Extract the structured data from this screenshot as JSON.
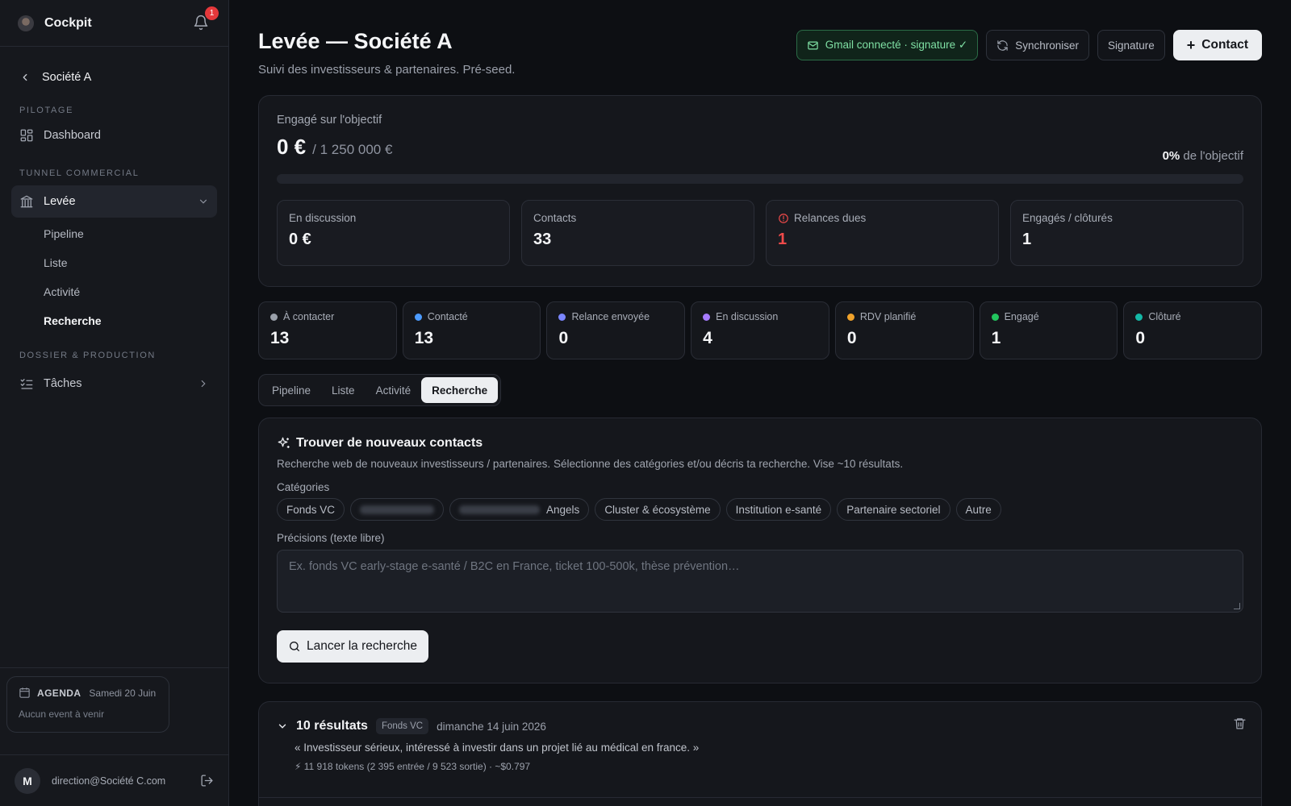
{
  "app": {
    "title": "Cockpit",
    "notifications": "1"
  },
  "sidebar": {
    "org": "Société A",
    "sections": {
      "pilotage": "PILOTAGE",
      "tunnel": "TUNNEL COMMERCIAL",
      "dossier": "DOSSIER & PRODUCTION"
    },
    "dashboard": "Dashboard",
    "levee": "Levée",
    "sub": [
      "Pipeline",
      "Liste",
      "Activité",
      "Recherche"
    ],
    "taches": "Tâches",
    "agenda": {
      "label": "AGENDA",
      "date": "Samedi 20 Juin",
      "empty": "Aucun event à venir"
    },
    "user": {
      "initial": "M",
      "email": "direction@Société C.com"
    }
  },
  "header": {
    "title": "Levée — Société A",
    "subtitle": "Suivi des investisseurs & partenaires. Pré-seed.",
    "gmail": "Gmail connecté · signature ✓",
    "sync": "Synchroniser",
    "signature": "Signature",
    "contact": "Contact"
  },
  "goal": {
    "label": "Engagé sur l'objectif",
    "amount": "0 €",
    "target": "/ 1 250 000 €",
    "pct": "0%",
    "pct_suffix": " de l'objectif",
    "progress": 0
  },
  "kpis": [
    {
      "label": "En discussion",
      "value": "0 €"
    },
    {
      "label": "Contacts",
      "value": "33"
    },
    {
      "label": "Relances dues",
      "value": "1"
    },
    {
      "label": "Engagés / clôturés",
      "value": "1"
    }
  ],
  "stages": [
    {
      "label": "À contacter",
      "value": "13",
      "color": "#9aa0aa"
    },
    {
      "label": "Contacté",
      "value": "13",
      "color": "#4c9bff"
    },
    {
      "label": "Relance envoyée",
      "value": "0",
      "color": "#7b86ff"
    },
    {
      "label": "En discussion",
      "value": "4",
      "color": "#a67bff"
    },
    {
      "label": "RDV planifié",
      "value": "0",
      "color": "#f0a22b"
    },
    {
      "label": "Engagé",
      "value": "1",
      "color": "#22c55e"
    },
    {
      "label": "Clôturé",
      "value": "0",
      "color": "#14b8a6"
    }
  ],
  "tabs": [
    "Pipeline",
    "Liste",
    "Activité",
    "Recherche"
  ],
  "search": {
    "title": "Trouver de nouveaux contacts",
    "desc": "Recherche web de nouveaux investisseurs / partenaires. Sélectionne des catégories et/ou décris ta recherche. Vise ~10 résultats.",
    "categories_label": "Catégories",
    "chips": [
      "Fonds VC",
      "Angels",
      "Cluster & écosystème",
      "Institution e-santé",
      "Partenaire sectoriel",
      "Autre"
    ],
    "precisions_label": "Précisions (texte libre)",
    "placeholder": "Ex. fonds VC early-stage e-santé / B2C en France, ticket 100-500k, thèse prévention…",
    "run": "Lancer la recherche"
  },
  "results": {
    "count": "10 résultats",
    "tag": "Fonds VC",
    "date": "dimanche 14 juin 2026",
    "quote": "« Investisseur sérieux, intéressé à investir dans un projet lié au médical en france. »",
    "meta": "⚡ 11 918 tokens (2 395 entrée / 9 523 sortie) · ~$0.797"
  }
}
